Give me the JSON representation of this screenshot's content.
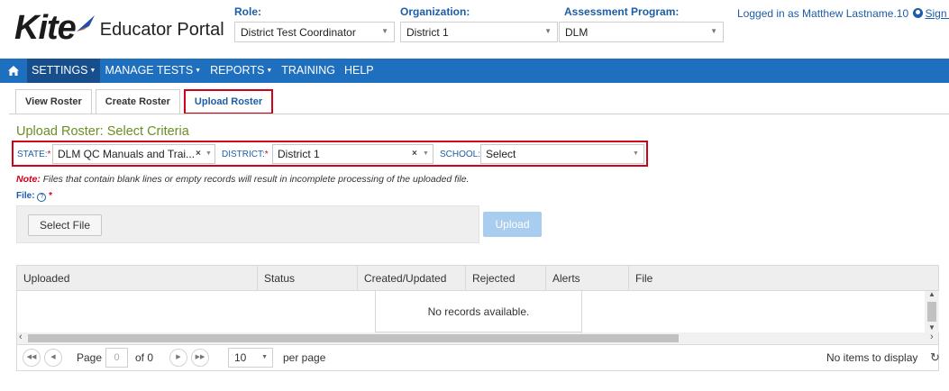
{
  "header": {
    "logo_word": "Kite",
    "portal_name": "Educator Portal",
    "role": {
      "label": "Role:",
      "value": "District Test Coordinator"
    },
    "organization": {
      "label": "Organization:",
      "value": "District 1"
    },
    "assessment_program": {
      "label": "Assessment Program:",
      "value": "DLM"
    },
    "login_text": "Logged in as Matthew Lastname.10",
    "sign_out": "Sign Out"
  },
  "nav": {
    "items": [
      {
        "label": "SETTINGS",
        "dropdown": true
      },
      {
        "label": "MANAGE TESTS",
        "dropdown": true
      },
      {
        "label": "REPORTS",
        "dropdown": true
      },
      {
        "label": "TRAINING",
        "dropdown": false
      },
      {
        "label": "HELP",
        "dropdown": false
      }
    ],
    "dropdown_glyph": "▼",
    "active": "SETTINGS"
  },
  "tabs": [
    {
      "label": "View Roster"
    },
    {
      "label": "Create Roster"
    },
    {
      "label": "Upload Roster"
    }
  ],
  "active_tab": "Upload Roster",
  "section_title": "Upload Roster: Select Criteria",
  "criteria": {
    "state_label": "STATE:",
    "state_value": "DLM QC Manuals and Trai...",
    "district_label": "DISTRICT:",
    "district_value": "District 1",
    "school_label": "SCHOOL:",
    "school_value": "Select",
    "required_mark": "*",
    "clear_glyph": "×",
    "caret_glyph": "▼"
  },
  "note": {
    "prefix": "Note:",
    "text": " Files that contain blank lines or empty records will result in incomplete processing of the uploaded file."
  },
  "file": {
    "label": "File:",
    "help_glyph": "?",
    "required_mark": "*",
    "select_button": "Select File",
    "upload_button": "Upload"
  },
  "grid": {
    "columns": [
      "Uploaded",
      "Status",
      "Created/Updated",
      "Rejected",
      "Alerts",
      "File"
    ],
    "empty_message": "No records available.",
    "pager": {
      "page_label": "Page",
      "page_value": "0",
      "of_text": "of 0",
      "page_size": "10",
      "per_page": "per page",
      "status": "No items to display"
    }
  },
  "colors": {
    "nav_bg": "#1f6fbf",
    "link_blue": "#1c5da8",
    "highlight_red": "#d0021b",
    "section_green": "#6b8e23",
    "upload_disabled": "#a9cdee"
  }
}
